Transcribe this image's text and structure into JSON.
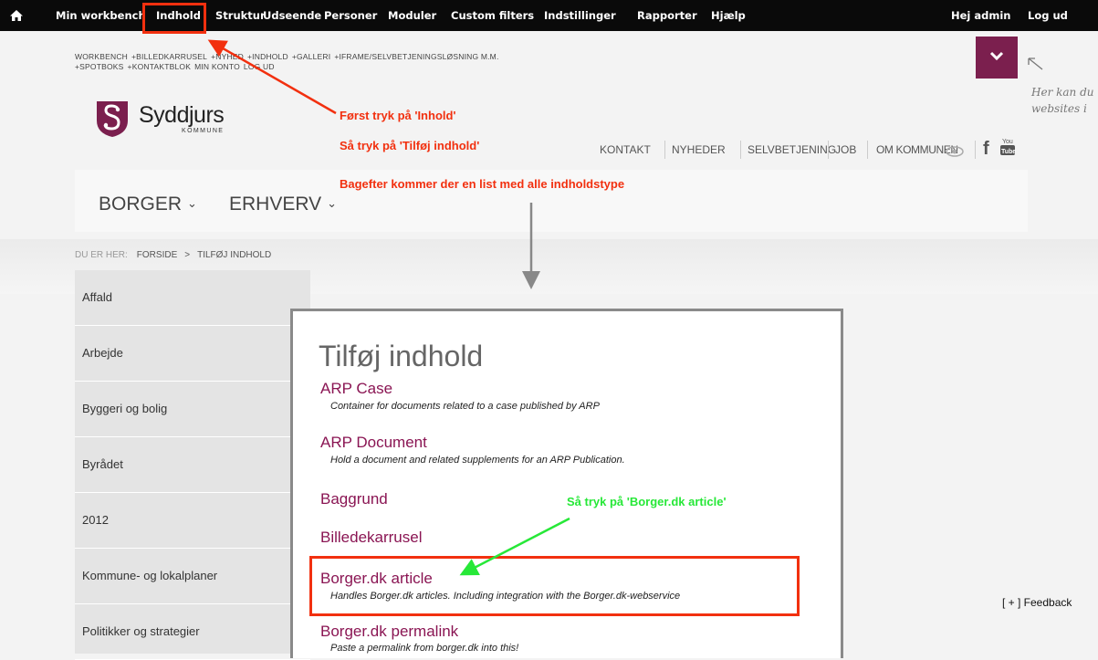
{
  "admin_bar": {
    "items": [
      "Min workbench",
      "Indhold",
      "Struktur",
      "Udseende",
      "Personer",
      "Moduler",
      "Custom filters",
      "Indstillinger",
      "Rapporter",
      "Hjælp"
    ],
    "greeting": "Hej admin",
    "logout": "Log ud"
  },
  "shortcuts": [
    "WORKBENCH",
    "+BILLEDKARRUSEL",
    "+NYHED",
    "+INDHOLD",
    "+GALLERI",
    "+IFRAME/SELVBETJENINGSLØSNING M.M.",
    "+SPOTBOKS",
    "+KONTAKTBLOK",
    "MIN KONTO",
    "LOG UD"
  ],
  "hint_text": [
    "Her kan du",
    "websites i"
  ],
  "logo": {
    "name": "Syddjurs",
    "sub": "KOMMUNE"
  },
  "top_nav": [
    "KONTAKT",
    "NYHEDER",
    "SELVBETJENING",
    "JOB",
    "OM KOMMUNEN"
  ],
  "annotations": {
    "step1": "Først tryk på 'Inhold'",
    "step2": "Så tryk på 'Tilføj indhold'",
    "step3": "Bagefter kommer der en list med alle indholdstype",
    "step4": "Så tryk på 'Borger.dk article'"
  },
  "main_nav": [
    "BORGER",
    "ERHVERV"
  ],
  "breadcrumb": {
    "prefix": "DU ER HER:",
    "items": [
      "FORSIDE",
      ">",
      "TILFØJ INDHOLD"
    ]
  },
  "sidebar": [
    "Affald",
    "Arbejde",
    "Byggeri og bolig",
    "Byrådet",
    "2012",
    "Kommune- og lokalplaner",
    "Politikker og strategier"
  ],
  "page_title": "Tilføj indhold",
  "content_types": [
    {
      "title": "ARP Case",
      "desc": "Container for documents related to a case published by ARP"
    },
    {
      "title": "ARP Document",
      "desc": "Hold a document and related supplements for an ARP Publication."
    },
    {
      "title": "Baggrund",
      "desc": ""
    },
    {
      "title": "Billedekarrusel",
      "desc": ""
    },
    {
      "title": "Borger.dk article",
      "desc": "Handles Borger.dk articles. Including integration with the Borger.dk-webservice"
    },
    {
      "title": "Borger.dk permalink",
      "desc": "Paste a permalink from borger.dk into this!"
    }
  ],
  "feedback": "[ + ] Feedback",
  "colors": {
    "accent": "#7b1f4e",
    "link": "#8a1553",
    "annotation_red": "#f2300f",
    "annotation_green": "#27e838"
  }
}
